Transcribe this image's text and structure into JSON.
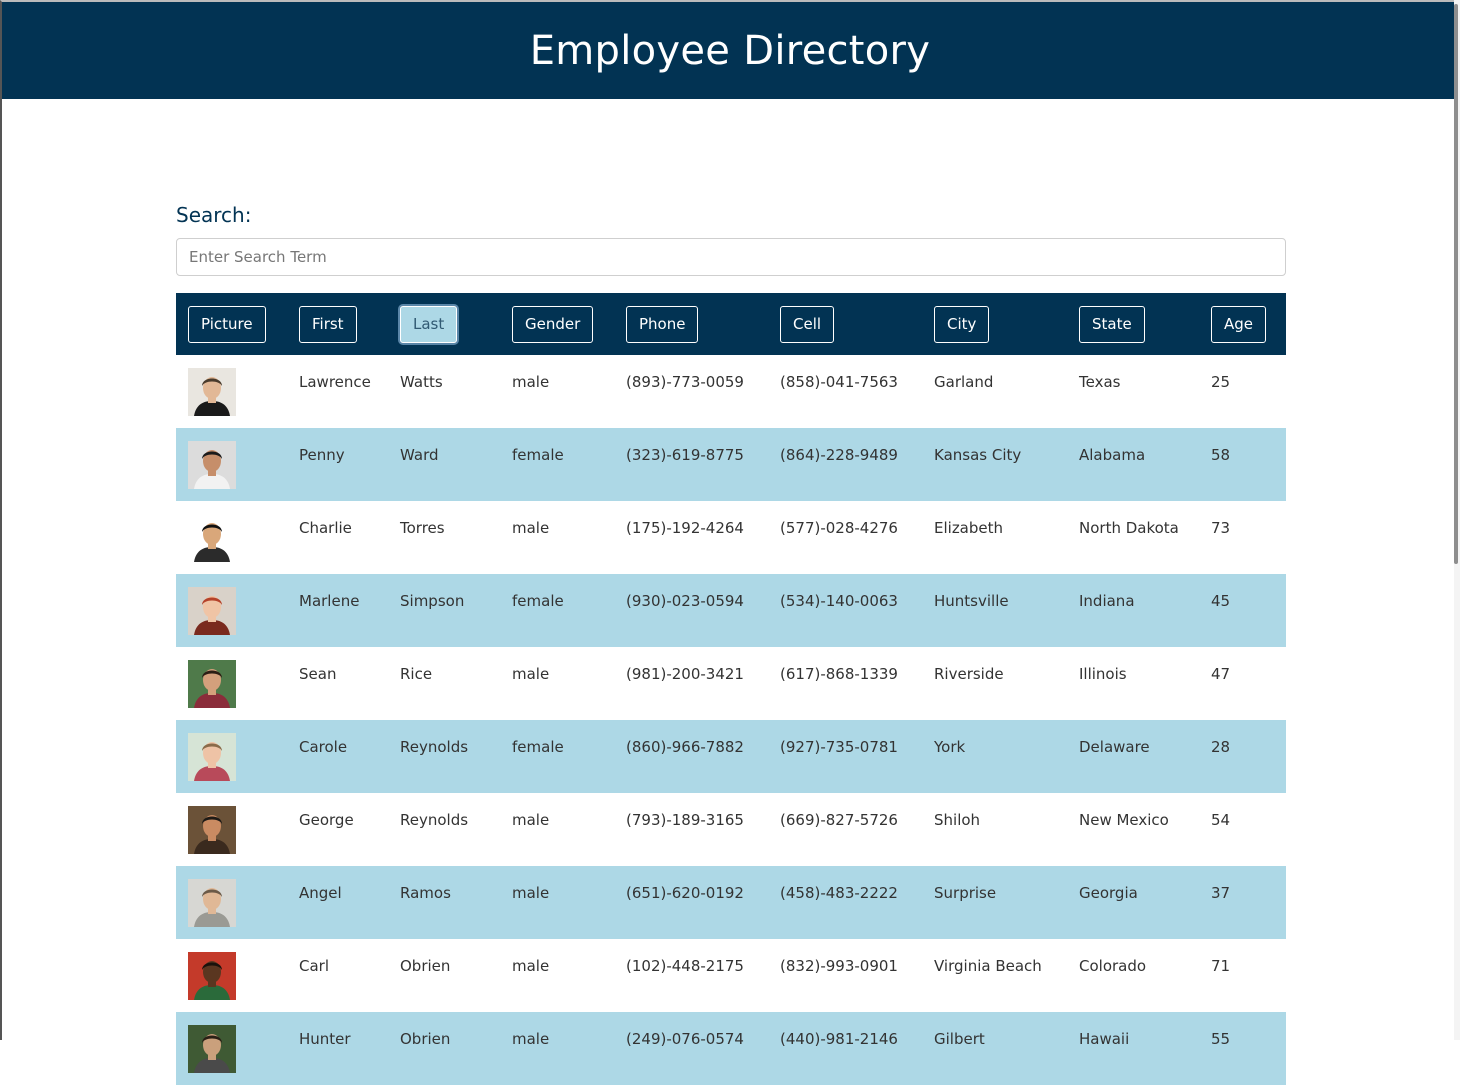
{
  "header": {
    "title": "Employee Directory"
  },
  "search": {
    "label": "Search:",
    "placeholder": "Enter Search Term",
    "value": ""
  },
  "table": {
    "columns": [
      "Picture",
      "First",
      "Last",
      "Gender",
      "Phone",
      "Cell",
      "City",
      "State",
      "Age"
    ],
    "active_sort_column": "Last",
    "rows": [
      {
        "first": "Lawrence",
        "last": "Watts",
        "gender": "male",
        "phone": "(893)-773-0059",
        "cell": "(858)-041-7563",
        "city": "Garland",
        "state": "Texas",
        "age": "25",
        "bg": "#e9e6e0",
        "skin": "#e2b896",
        "hair": "#4a3b2c",
        "shirt": "#1a1a1a"
      },
      {
        "first": "Penny",
        "last": "Ward",
        "gender": "female",
        "phone": "(323)-619-8775",
        "cell": "(864)-228-9489",
        "city": "Kansas City",
        "state": "Alabama",
        "age": "58",
        "bg": "#dcdcdc",
        "skin": "#c68e6a",
        "hair": "#1b1b1b",
        "shirt": "#f2f2f2"
      },
      {
        "first": "Charlie",
        "last": "Torres",
        "gender": "male",
        "phone": "(175)-192-4264",
        "cell": "(577)-028-4276",
        "city": "Elizabeth",
        "state": "North Dakota",
        "age": "73",
        "bg": "#ffffff",
        "skin": "#d9a77a",
        "hair": "#111111",
        "shirt": "#2b2b2b"
      },
      {
        "first": "Marlene",
        "last": "Simpson",
        "gender": "female",
        "phone": "(930)-023-0594",
        "cell": "(534)-140-0063",
        "city": "Huntsville",
        "state": "Indiana",
        "age": "45",
        "bg": "#d9d2c9",
        "skin": "#f0c4a5",
        "hair": "#b5422a",
        "shirt": "#7a2a1e"
      },
      {
        "first": "Sean",
        "last": "Rice",
        "gender": "male",
        "phone": "(981)-200-3421",
        "cell": "(617)-868-1339",
        "city": "Riverside",
        "state": "Illinois",
        "age": "47",
        "bg": "#4f7a4a",
        "skin": "#d4a07c",
        "hair": "#2b1e14",
        "shirt": "#8a2c3a"
      },
      {
        "first": "Carole",
        "last": "Reynolds",
        "gender": "female",
        "phone": "(860)-966-7882",
        "cell": "(927)-735-0781",
        "city": "York",
        "state": "Delaware",
        "age": "28",
        "bg": "#d6e4d6",
        "skin": "#eec3a6",
        "hair": "#8a6b4a",
        "shirt": "#b84a5a"
      },
      {
        "first": "George",
        "last": "Reynolds",
        "gender": "male",
        "phone": "(793)-189-3165",
        "cell": "(669)-827-5726",
        "city": "Shiloh",
        "state": "New Mexico",
        "age": "54",
        "bg": "#6b5238",
        "skin": "#c98b62",
        "hair": "#1e1a16",
        "shirt": "#3a2a1e"
      },
      {
        "first": "Angel",
        "last": "Ramos",
        "gender": "male",
        "phone": "(651)-620-0192",
        "cell": "(458)-483-2222",
        "city": "Surprise",
        "state": "Georgia",
        "age": "37",
        "bg": "#d7d7d3",
        "skin": "#e0b896",
        "hair": "#6b5a48",
        "shirt": "#9a9a94"
      },
      {
        "first": "Carl",
        "last": "Obrien",
        "gender": "male",
        "phone": "(102)-448-2175",
        "cell": "(832)-993-0901",
        "city": "Virginia Beach",
        "state": "Colorado",
        "age": "71",
        "bg": "#c43a2a",
        "skin": "#5a3620",
        "hair": "#1a120c",
        "shirt": "#2a6a3a"
      },
      {
        "first": "Hunter",
        "last": "Obrien",
        "gender": "male",
        "phone": "(249)-076-0574",
        "cell": "(440)-981-2146",
        "city": "Gilbert",
        "state": "Hawaii",
        "age": "55",
        "bg": "#3f5a34",
        "skin": "#caa07c",
        "hair": "#2a2016",
        "shirt": "#4a4a4a"
      }
    ]
  }
}
